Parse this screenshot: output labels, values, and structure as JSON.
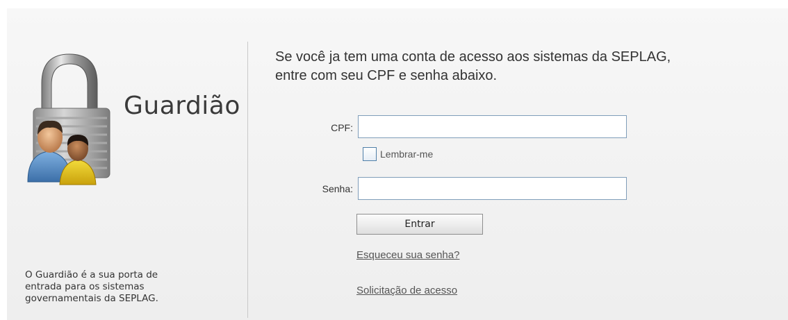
{
  "app": {
    "name": "Guardião",
    "tagline_lines": [
      "O Guardião é a sua porta de",
      "entrada para os sistemas",
      "governamentais da SEPLAG."
    ]
  },
  "intro": {
    "lines": [
      "Se você ja tem uma conta de acesso aos sistemas da SEPLAG,",
      "entre com seu CPF e senha abaixo."
    ]
  },
  "form": {
    "cpf_label": "CPF:",
    "cpf_value": "",
    "remember_label": "Lembrar-me",
    "remember_checked": false,
    "senha_label": "Senha:",
    "senha_value": "",
    "submit_label": "Entrar"
  },
  "links": {
    "forgot_password": "Esqueceu sua senha?",
    "request_access": "Solicitação de acesso"
  },
  "icons": {
    "logo": "padlock-users-icon"
  }
}
